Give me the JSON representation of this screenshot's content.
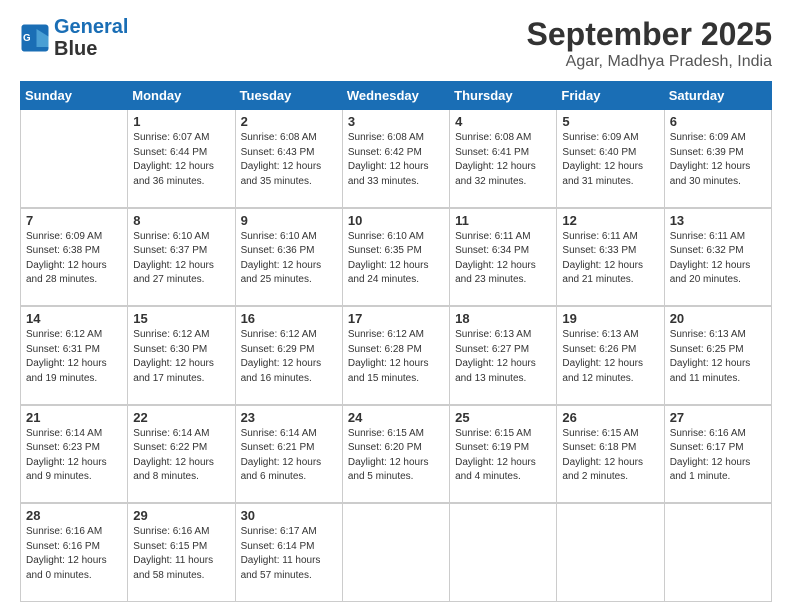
{
  "header": {
    "logo_line1": "General",
    "logo_line2": "Blue",
    "month": "September 2025",
    "location": "Agar, Madhya Pradesh, India"
  },
  "days_of_week": [
    "Sunday",
    "Monday",
    "Tuesday",
    "Wednesday",
    "Thursday",
    "Friday",
    "Saturday"
  ],
  "weeks": [
    [
      {
        "day": "",
        "info": ""
      },
      {
        "day": "1",
        "info": "Sunrise: 6:07 AM\nSunset: 6:44 PM\nDaylight: 12 hours\nand 36 minutes."
      },
      {
        "day": "2",
        "info": "Sunrise: 6:08 AM\nSunset: 6:43 PM\nDaylight: 12 hours\nand 35 minutes."
      },
      {
        "day": "3",
        "info": "Sunrise: 6:08 AM\nSunset: 6:42 PM\nDaylight: 12 hours\nand 33 minutes."
      },
      {
        "day": "4",
        "info": "Sunrise: 6:08 AM\nSunset: 6:41 PM\nDaylight: 12 hours\nand 32 minutes."
      },
      {
        "day": "5",
        "info": "Sunrise: 6:09 AM\nSunset: 6:40 PM\nDaylight: 12 hours\nand 31 minutes."
      },
      {
        "day": "6",
        "info": "Sunrise: 6:09 AM\nSunset: 6:39 PM\nDaylight: 12 hours\nand 30 minutes."
      }
    ],
    [
      {
        "day": "7",
        "info": "Sunrise: 6:09 AM\nSunset: 6:38 PM\nDaylight: 12 hours\nand 28 minutes."
      },
      {
        "day": "8",
        "info": "Sunrise: 6:10 AM\nSunset: 6:37 PM\nDaylight: 12 hours\nand 27 minutes."
      },
      {
        "day": "9",
        "info": "Sunrise: 6:10 AM\nSunset: 6:36 PM\nDaylight: 12 hours\nand 25 minutes."
      },
      {
        "day": "10",
        "info": "Sunrise: 6:10 AM\nSunset: 6:35 PM\nDaylight: 12 hours\nand 24 minutes."
      },
      {
        "day": "11",
        "info": "Sunrise: 6:11 AM\nSunset: 6:34 PM\nDaylight: 12 hours\nand 23 minutes."
      },
      {
        "day": "12",
        "info": "Sunrise: 6:11 AM\nSunset: 6:33 PM\nDaylight: 12 hours\nand 21 minutes."
      },
      {
        "day": "13",
        "info": "Sunrise: 6:11 AM\nSunset: 6:32 PM\nDaylight: 12 hours\nand 20 minutes."
      }
    ],
    [
      {
        "day": "14",
        "info": "Sunrise: 6:12 AM\nSunset: 6:31 PM\nDaylight: 12 hours\nand 19 minutes."
      },
      {
        "day": "15",
        "info": "Sunrise: 6:12 AM\nSunset: 6:30 PM\nDaylight: 12 hours\nand 17 minutes."
      },
      {
        "day": "16",
        "info": "Sunrise: 6:12 AM\nSunset: 6:29 PM\nDaylight: 12 hours\nand 16 minutes."
      },
      {
        "day": "17",
        "info": "Sunrise: 6:12 AM\nSunset: 6:28 PM\nDaylight: 12 hours\nand 15 minutes."
      },
      {
        "day": "18",
        "info": "Sunrise: 6:13 AM\nSunset: 6:27 PM\nDaylight: 12 hours\nand 13 minutes."
      },
      {
        "day": "19",
        "info": "Sunrise: 6:13 AM\nSunset: 6:26 PM\nDaylight: 12 hours\nand 12 minutes."
      },
      {
        "day": "20",
        "info": "Sunrise: 6:13 AM\nSunset: 6:25 PM\nDaylight: 12 hours\nand 11 minutes."
      }
    ],
    [
      {
        "day": "21",
        "info": "Sunrise: 6:14 AM\nSunset: 6:23 PM\nDaylight: 12 hours\nand 9 minutes."
      },
      {
        "day": "22",
        "info": "Sunrise: 6:14 AM\nSunset: 6:22 PM\nDaylight: 12 hours\nand 8 minutes."
      },
      {
        "day": "23",
        "info": "Sunrise: 6:14 AM\nSunset: 6:21 PM\nDaylight: 12 hours\nand 6 minutes."
      },
      {
        "day": "24",
        "info": "Sunrise: 6:15 AM\nSunset: 6:20 PM\nDaylight: 12 hours\nand 5 minutes."
      },
      {
        "day": "25",
        "info": "Sunrise: 6:15 AM\nSunset: 6:19 PM\nDaylight: 12 hours\nand 4 minutes."
      },
      {
        "day": "26",
        "info": "Sunrise: 6:15 AM\nSunset: 6:18 PM\nDaylight: 12 hours\nand 2 minutes."
      },
      {
        "day": "27",
        "info": "Sunrise: 6:16 AM\nSunset: 6:17 PM\nDaylight: 12 hours\nand 1 minute."
      }
    ],
    [
      {
        "day": "28",
        "info": "Sunrise: 6:16 AM\nSunset: 6:16 PM\nDaylight: 12 hours\nand 0 minutes."
      },
      {
        "day": "29",
        "info": "Sunrise: 6:16 AM\nSunset: 6:15 PM\nDaylight: 11 hours\nand 58 minutes."
      },
      {
        "day": "30",
        "info": "Sunrise: 6:17 AM\nSunset: 6:14 PM\nDaylight: 11 hours\nand 57 minutes."
      },
      {
        "day": "",
        "info": ""
      },
      {
        "day": "",
        "info": ""
      },
      {
        "day": "",
        "info": ""
      },
      {
        "day": "",
        "info": ""
      }
    ]
  ]
}
